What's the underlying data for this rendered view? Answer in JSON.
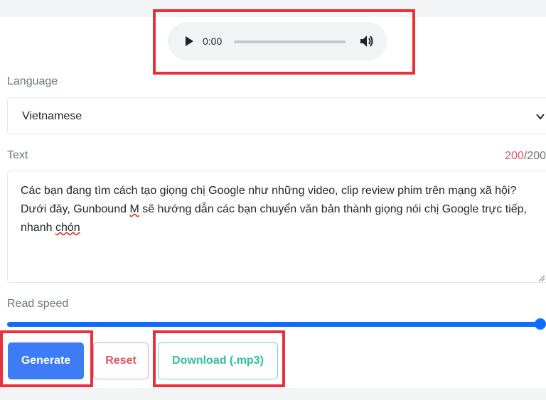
{
  "player": {
    "time": "0:00",
    "progress": 0
  },
  "language": {
    "label": "Language",
    "selected": "Vietnamese"
  },
  "text": {
    "label": "Text",
    "count_current": "200",
    "count_sep_max": "/200",
    "content_before": "Các bạn đang tìm cách tạo giọng chị Google như những video, clip review phim trên mạng xã hội? Dưới đây, Gunbound ",
    "content_m": "M",
    "content_middle": " sẽ hướng dẫn các bạn chuyển văn bản thành giọng nói chị Google trực tiếp, nhanh ",
    "content_last": "chón"
  },
  "speed": {
    "label": "Read speed",
    "value_fraction": 1.0
  },
  "buttons": {
    "generate": "Generate",
    "reset": "Reset",
    "download": "Download (.mp3)"
  },
  "colors": {
    "highlight": "#e8313a",
    "primary": "#3d7cf4",
    "danger": "#e25563",
    "success": "#2cc29a"
  }
}
